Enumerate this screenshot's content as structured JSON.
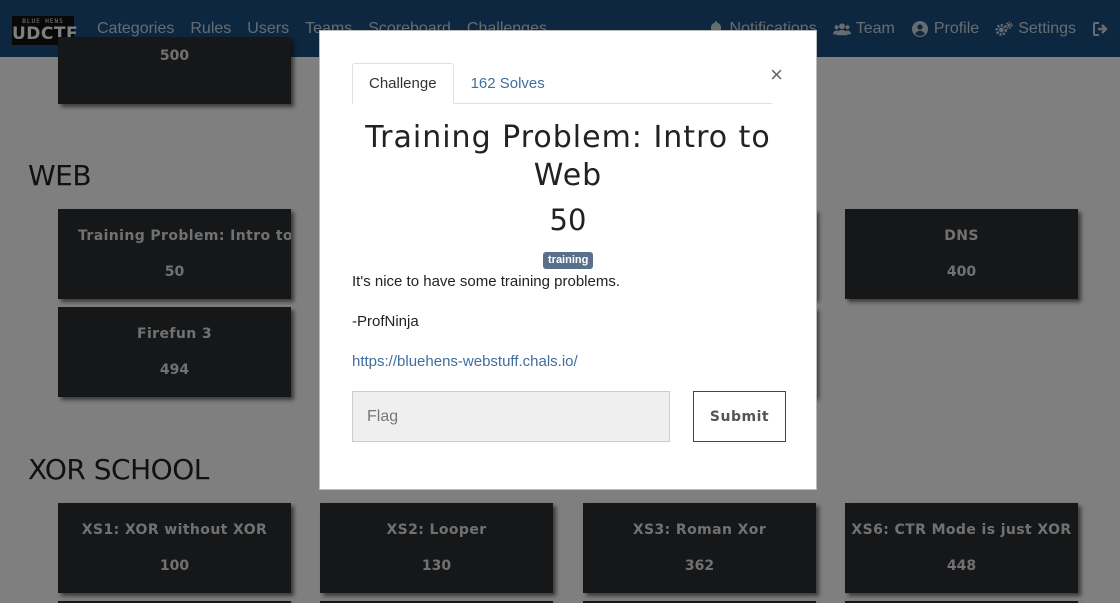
{
  "navbar": {
    "logo_small": "BLUE HENS",
    "logo_big": "UDCTF",
    "left_links": [
      {
        "label": "Categories"
      },
      {
        "label": "Rules"
      },
      {
        "label": "Users"
      },
      {
        "label": "Teams"
      },
      {
        "label": "Scoreboard"
      },
      {
        "label": "Challenges"
      }
    ],
    "right_links": [
      {
        "label": "Notifications",
        "icon": "bell-icon"
      },
      {
        "label": "Team",
        "icon": "users-icon"
      },
      {
        "label": "Profile",
        "icon": "user-circle-icon"
      },
      {
        "label": "Settings",
        "icon": "gears-icon"
      },
      {
        "label": "",
        "icon": "logout-icon"
      }
    ]
  },
  "categories": [
    {
      "name": "",
      "challenges": [
        {
          "name": "",
          "value": "500"
        }
      ]
    },
    {
      "name": "WEB",
      "challenges": [
        {
          "name": "Training Problem: Intro to Web",
          "value": "50"
        },
        {
          "name": "DNS",
          "value": "400"
        },
        {
          "name": "Firefun 3",
          "value": "494"
        }
      ]
    },
    {
      "name": "XOR SCHOOL",
      "challenges": [
        {
          "name": "XS1: XOR without XOR",
          "value": "100"
        },
        {
          "name": "XS2: Looper",
          "value": "130"
        },
        {
          "name": "XS3: Roman Xor",
          "value": "362"
        },
        {
          "name": "XS6: CTR Mode is just XOR",
          "value": "448"
        }
      ]
    }
  ],
  "modal": {
    "tabs": [
      {
        "label": "Challenge",
        "active": true
      },
      {
        "label": "162 Solves",
        "active": false
      }
    ],
    "close_label": "×",
    "title": "Training Problem: Intro to Web",
    "value": "50",
    "tag": "training",
    "description": [
      "It's nice to have some training problems.",
      "-ProfNinja"
    ],
    "link": "https://bluehens-webstuff.chals.io/",
    "flag_placeholder": "Flag",
    "submit_label": "Submit"
  },
  "colors": {
    "navbar": "#1c4e80",
    "card": "#2b2e33",
    "link": "#3f6f9f",
    "badge": "#58708c"
  }
}
